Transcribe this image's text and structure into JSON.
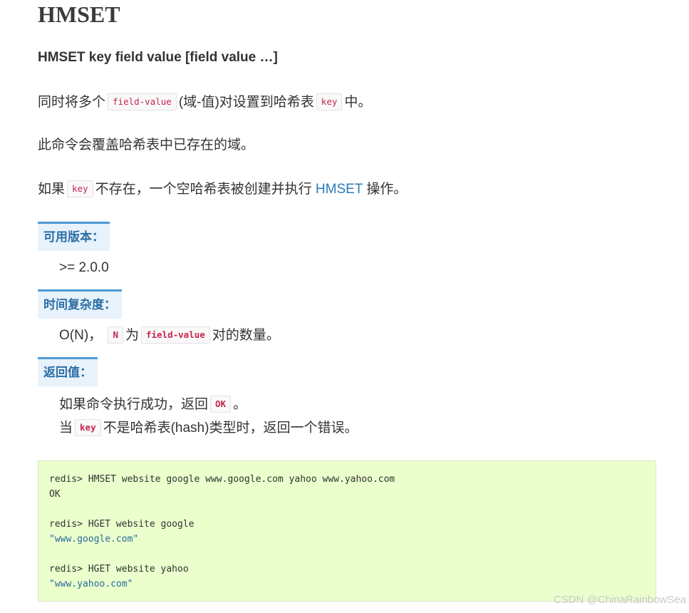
{
  "title": "HMSET",
  "signature": "HMSET key field value [field value …]",
  "p1": {
    "before": "同时将多个",
    "code1": "field-value",
    "middle": "(域-值)对设置到哈希表",
    "code2": "key",
    "after": "中。"
  },
  "p2": "此命令会覆盖哈希表中已存在的域。",
  "p3": {
    "before": "如果",
    "code": "key",
    "middle": "不存在，一个空哈希表被创建并执行",
    "link": "HMSET",
    "after": "操作。"
  },
  "sections": {
    "available": {
      "label": "可用版本：",
      "value": ">= 2.0.0"
    },
    "complexity": {
      "label": "时间复杂度：",
      "before": "O(N)，",
      "code1": "N",
      "middle": "为",
      "code2": "field-value",
      "after": "对的数量。"
    },
    "returns": {
      "label": "返回值：",
      "line1": {
        "before": "如果命令执行成功，返回",
        "code": "OK",
        "after": "。"
      },
      "line2": {
        "before": "当",
        "code": "key",
        "after": "不是哈希表(hash)类型时，返回一个错误。"
      }
    }
  },
  "example": {
    "lines": [
      {
        "text": "redis> HMSET website google www.google.com yahoo www.yahoo.com",
        "kind": "cmd"
      },
      {
        "text": "OK",
        "kind": "out"
      },
      {
        "text": "",
        "kind": "blank"
      },
      {
        "text": "redis> HGET website google",
        "kind": "cmd"
      },
      {
        "text": "\"www.google.com\"",
        "kind": "str"
      },
      {
        "text": "",
        "kind": "blank"
      },
      {
        "text": "redis> HGET website yahoo",
        "kind": "cmd"
      },
      {
        "text": "\"www.yahoo.com\"",
        "kind": "str"
      }
    ]
  },
  "watermark": "CSDN @ChinaRainbowSea"
}
